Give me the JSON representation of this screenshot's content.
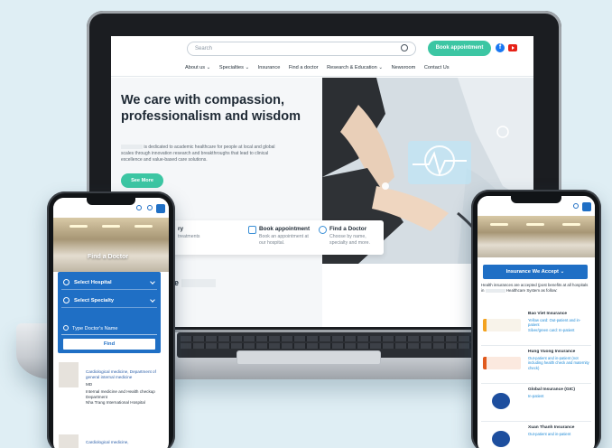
{
  "laptop": {
    "search_placeholder": "Search",
    "book_button": "Book appointment",
    "nav": [
      "About us ⌄",
      "Specialties ⌄",
      "Insurance",
      "Find a doctor",
      "Research & Education ⌄",
      "Newsroom",
      "Contact Us"
    ],
    "hero_title": "We care with compassion, professionalism and wisdom",
    "hero_desc": "is dedicated to academic healthcare for people at local and global scales through innovation research and breakthroughs that lead to clinical excellence and value-based care solutions.",
    "see_more": "See More",
    "cards": [
      {
        "title": "Book appointment",
        "desc": "Book an appointment at our hospital."
      },
      {
        "title": "Find a Doctor",
        "desc": "Choose by name, specialty and more."
      }
    ],
    "card_partial_title": "ry",
    "card_partial_desc": "treatments",
    "bottom_text": "e"
  },
  "phone_left": {
    "banner_title": "Find a Doctor",
    "select_hospital": "Select Hospital",
    "select_specialty": "Select Specialty",
    "doctor_name_placeholder": "Type Doctor's Name",
    "find_button": "Find",
    "doctor": {
      "spec1": "Cardiological medicine, Department of general internal medicine",
      "degree": "MD",
      "spec2": "Internal medicine and Health checkup Department",
      "hospital": "Nha Trang International Hospital"
    },
    "doctor2_spec": "Cardiological medicine,"
  },
  "phone_right": {
    "insurance_button": "Insurance We Accept ⌄",
    "insurance_desc_a": "Health insurances are accepted (post benefits at all hospitals in",
    "insurance_desc_b": "Healthcare System as follow:",
    "items": [
      {
        "name": "Bao Viet Insurance",
        "detail": "Yellow card: Out-patient and in-patient\nSilver/green card: In-patient",
        "logo_color": "#f3a321"
      },
      {
        "name": "Hung Vuong Insurance",
        "detail": "Out-patient and in-patient (not including health check and maternity check)",
        "logo_color": "#e05a1d"
      },
      {
        "name": "Global Insurance (GIC)",
        "detail": "In-patient",
        "logo_color": "#1d4e9e"
      },
      {
        "name": "Xuan Thanh Insurance",
        "detail": "Out-patient and in-patient",
        "logo_color": "#1d4e9e"
      }
    ]
  }
}
